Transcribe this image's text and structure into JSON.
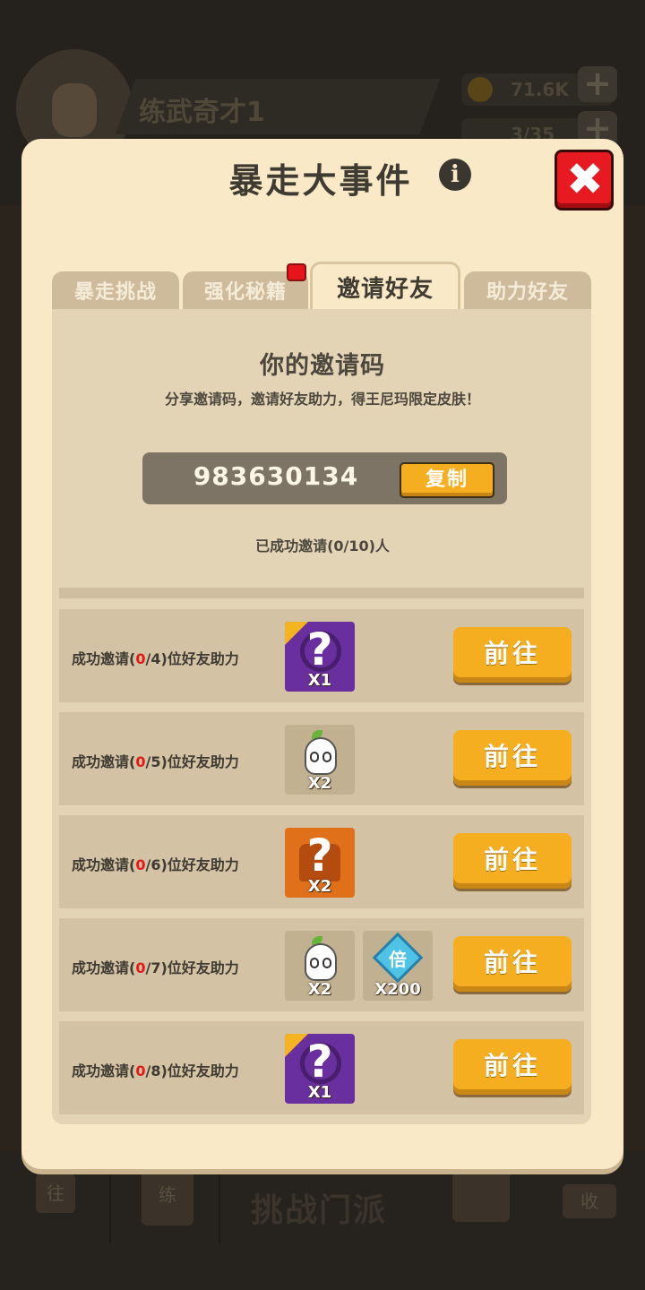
{
  "background": {
    "player_name": "练武奇才1",
    "coins": "71.6K",
    "energy": "3/35",
    "nav_center_label": "挑战门派",
    "nav_left_icon_label": "往",
    "nav_book_label": "练",
    "nav_right_icon_label": "收"
  },
  "dialog": {
    "title": "暴走大事件",
    "info_icon_glyph": "i",
    "close_glyph": "✖",
    "tabs": [
      {
        "label": "暴走挑战",
        "active": false
      },
      {
        "label": "强化秘籍",
        "active": false,
        "badge": true
      },
      {
        "label": "邀请好友",
        "active": true
      },
      {
        "label": "助力好友",
        "active": false
      }
    ],
    "invite": {
      "title": "你的邀请码",
      "description": "分享邀请码，邀请好友助力，得王尼玛限定皮肤！",
      "code": "983630134",
      "copy_label": "复制",
      "success_text": "已成功邀请(0/10)人"
    },
    "rows": [
      {
        "prefix": "成功邀请(",
        "progress": "0",
        "target": "/4",
        "suffix": ")位好友助力",
        "rewards": [
          {
            "type": "purple-mystery",
            "icon": "mystery-box-icon",
            "count": "X1"
          }
        ],
        "button": "前往"
      },
      {
        "prefix": "成功邀请(",
        "progress": "0",
        "target": "/5",
        "suffix": ")位好友助力",
        "rewards": [
          {
            "type": "ghost-item",
            "icon": "ghost-icon",
            "count": "X2"
          }
        ],
        "button": "前往"
      },
      {
        "prefix": "成功邀请(",
        "progress": "0",
        "target": "/6",
        "suffix": ")位好友助力",
        "rewards": [
          {
            "type": "orange-mystery-shirt",
            "icon": "mystery-shirt-icon",
            "count": "X2"
          }
        ],
        "button": "前往"
      },
      {
        "prefix": "成功邀请(",
        "progress": "0",
        "target": "/7",
        "suffix": ")位好友助力",
        "rewards": [
          {
            "type": "ghost-item",
            "icon": "ghost-icon",
            "count": "X2"
          },
          {
            "type": "multiplier-gem",
            "icon": "gem-icon",
            "gem_label": "倍",
            "count": "X200"
          }
        ],
        "button": "前往"
      },
      {
        "prefix": "成功邀请(",
        "progress": "0",
        "target": "/8",
        "suffix": ")位好友助力",
        "rewards": [
          {
            "type": "purple-mystery",
            "icon": "mystery-box-icon",
            "count": "X1"
          }
        ],
        "button": "前往"
      }
    ]
  },
  "colors": {
    "dialog_bg": "#f9e9c6",
    "panel_bg": "#e3d4b5",
    "button_orange": "#f5ae20",
    "close_red": "#e61a20",
    "progress_red": "#e11a1a"
  }
}
